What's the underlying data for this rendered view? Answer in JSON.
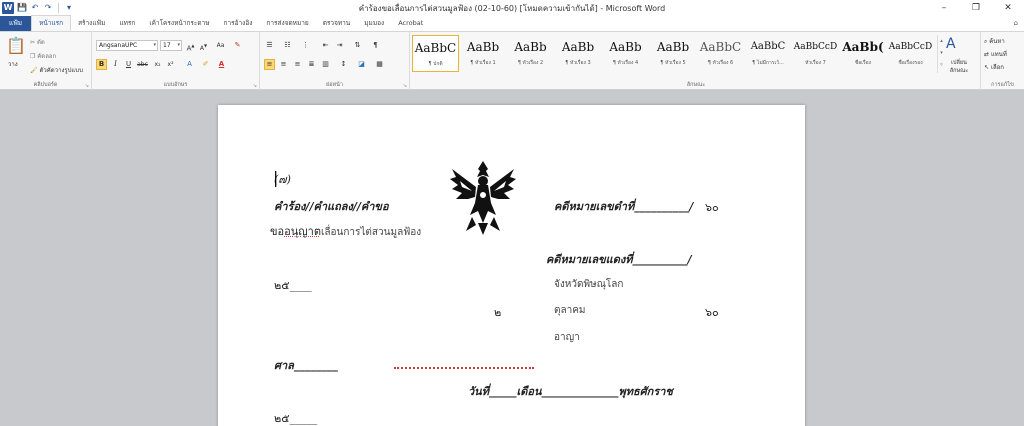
{
  "window": {
    "title": "คำร้องขอเลื่อนการไต่สวนมูลฟ้อง (02-10-60) [โหมดความเข้ากันได้] - Microsoft Word",
    "app_icon": "W",
    "minimize": "–",
    "restore": "❐",
    "close": "✕"
  },
  "qat": {
    "save": "💾",
    "undo": "↶",
    "redo": "↷",
    "customize": "▾"
  },
  "tabs": [
    "แฟ้ม",
    "หน้าแรก",
    "สร้างแฟ้ม",
    "แทรก",
    "เค้าโครงหน้ากระดาษ",
    "การอ้างอิง",
    "การส่งจดหมาย",
    "ตรวจทาน",
    "มุมมอง",
    "Acrobat"
  ],
  "active_tab": "หน้าแรก",
  "ribbon": {
    "clipboard": {
      "label": "คลิปบอร์ด",
      "paste": "วาง",
      "cut": "ตัด",
      "copy": "คัดลอก",
      "format_painter": "ตัวคัดวางรูปแบบ"
    },
    "font": {
      "label": "แบบอักษร",
      "font_name": "AngsanaUPC",
      "font_size": "17"
    },
    "paragraph": {
      "label": "ย่อหน้า"
    },
    "styles": {
      "label": "ลักษณะ",
      "items": [
        {
          "sample": "AaBbC",
          "name": "¶ ปกติ"
        },
        {
          "sample": "AaBb",
          "name": "¶ หัวเรื่อง 1"
        },
        {
          "sample": "AaBb",
          "name": "¶ หัวเรื่อง 2"
        },
        {
          "sample": "AaBb",
          "name": "¶ หัวเรื่อง 3"
        },
        {
          "sample": "AaBb",
          "name": "¶ หัวเรื่อง 4"
        },
        {
          "sample": "AaBb",
          "name": "¶ หัวเรื่อง 5"
        },
        {
          "sample": "AaBbC",
          "name": "¶ หัวเรื่อง 6"
        },
        {
          "sample": "AaBbC",
          "name": "¶ ไม่มีการเว้..."
        },
        {
          "sample": "AaBbCcD",
          "name": "หัวเรื่อง 7"
        },
        {
          "sample": "AaBb(",
          "name": "ชื่อเรื่อง"
        },
        {
          "sample": "AaBbCcD",
          "name": "ชื่อเรื่องรอง"
        }
      ],
      "change_styles": "เปลี่ยนลักษณะ"
    },
    "editing": {
      "label": "การแก้ไข",
      "find": "ค้นหา",
      "replace": "แทนที่",
      "select": "เลือก"
    }
  },
  "document": {
    "form_number": "(๗)",
    "heading_left": "คำร้อง//คำแถลง//คำขอ",
    "case_black": "คดีหมายเลขดำที่__________/",
    "year_60_a": "๖๐",
    "subject_a": "ขอ",
    "subject_b": "อนุญาต",
    "subject_c": "เลื่อนการไต่สวนมูลฟ้อง",
    "case_red": "คดีหมายเลขแดงที่__________/",
    "year_25_a": "๒๕____",
    "province": "จังหวัดพิษณุโลก",
    "day": "๒",
    "month": "ตุลาคม",
    "year_60_b": "๖๐",
    "case_type": "อาญา",
    "court": "ศาล________",
    "date_line": "วันที่_____เดือน______________พุทธศักราช",
    "year_25_b": "๒๕_____"
  },
  "colors": {
    "accent": "#2b579a",
    "page": "#ffffff",
    "workspace": "#c8c9cc"
  }
}
